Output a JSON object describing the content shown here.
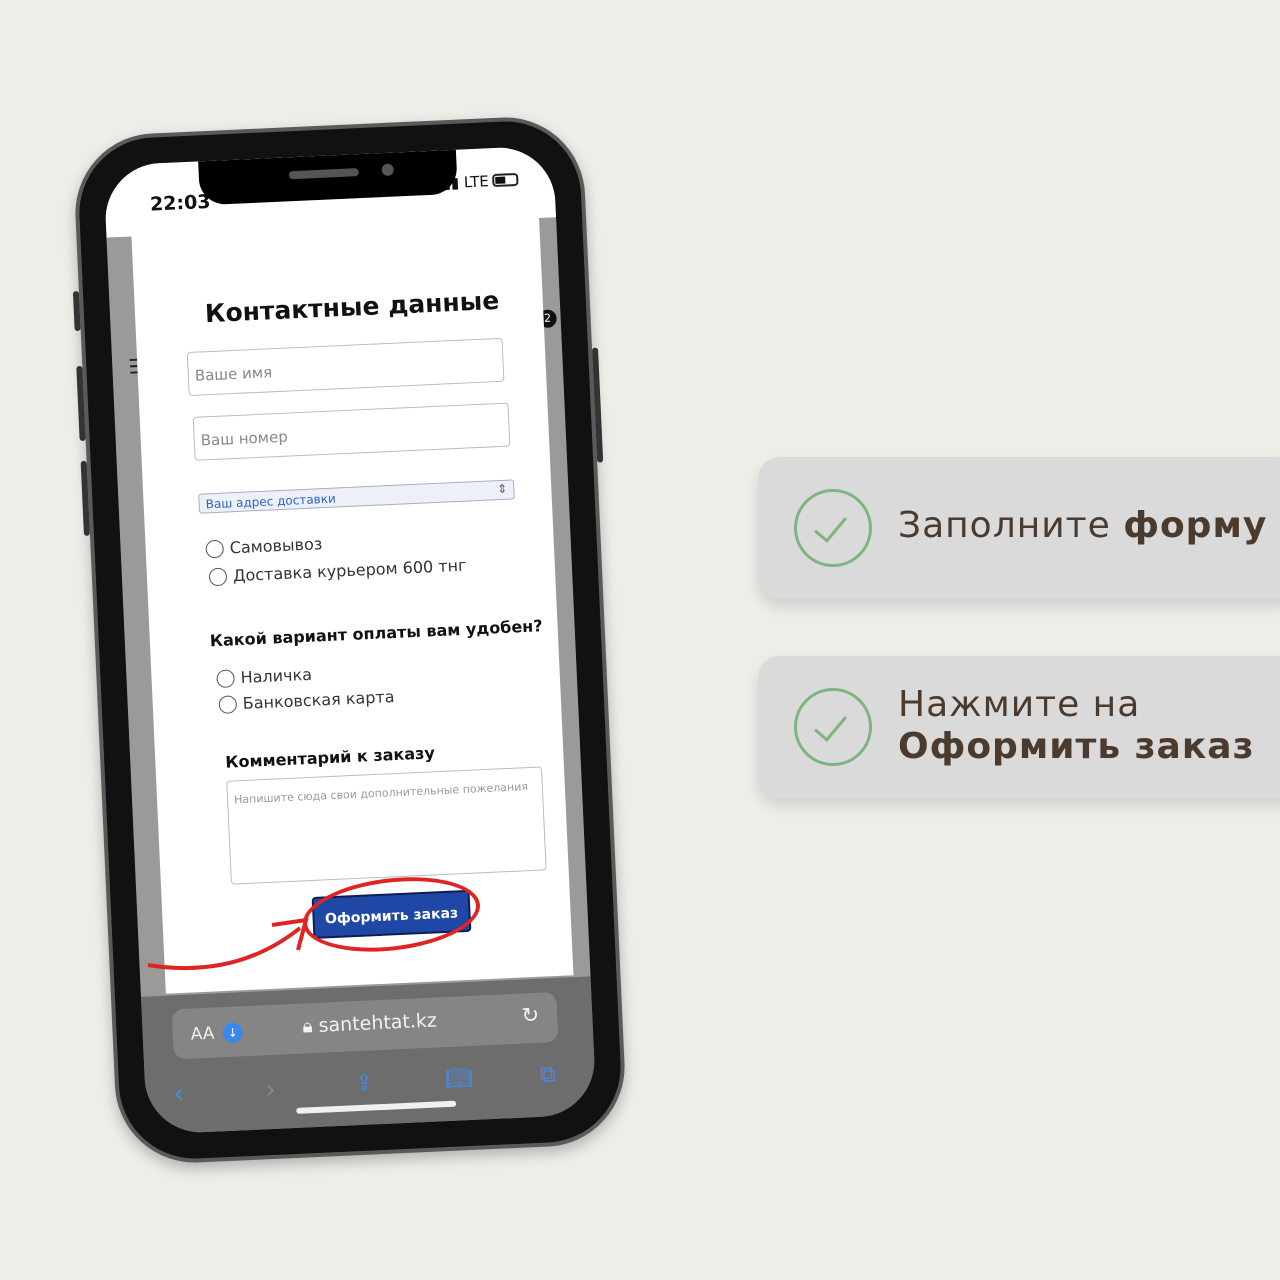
{
  "status_bar": {
    "time": "22:03",
    "network": "LTE",
    "cart_count": "2"
  },
  "form": {
    "title": "Контактные данные",
    "name_placeholder": "Ваше имя",
    "phone_placeholder": "Ваш номер",
    "address_select": "Ваш адрес доставки",
    "delivery_options": [
      "Самовывоз",
      "Доставка курьером 600 тнг"
    ],
    "payment_question": "Какой вариант оплаты вам удобен?",
    "payment_options": [
      "Наличка",
      "Банковская карта"
    ],
    "comment_label": "Комментарий к заказу",
    "comment_placeholder": "Напишите сюда свои дополнительные пожелания",
    "submit_label": "Оформить заказ"
  },
  "browser": {
    "text_size": "AA",
    "url": "santehtat.kz"
  },
  "steps": [
    {
      "text": "Заполните ",
      "bold": "форму"
    },
    {
      "text": "Нажмите на",
      "bold": "Оформить заказ"
    }
  ],
  "colors": {
    "accent_green": "#7fb47f",
    "button_blue": "#1f47a6",
    "highlight_red": "#e02424"
  }
}
